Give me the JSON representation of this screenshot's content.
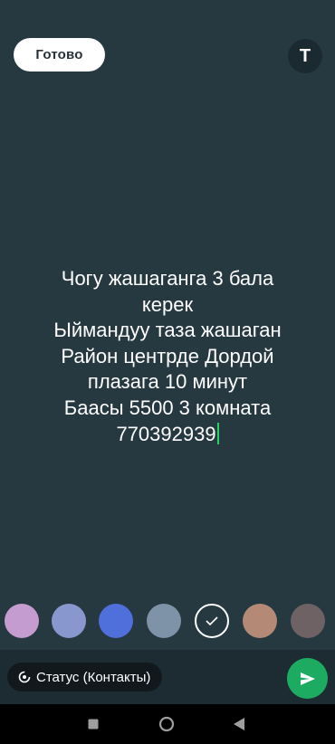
{
  "header": {
    "done_label": "Готово",
    "text_tool_label": "T"
  },
  "editor": {
    "text": "Чогу жашаганга 3 бала\nкерек\nЫймандуу таза жашаган\nРайон центрде Дордой\nплазага 10 минут\nБаасы 5500 3 комната\n770392939",
    "background_color": "#263941",
    "caret_color": "#25d366"
  },
  "palette": {
    "colors": [
      "#c59ccf",
      "#8997cf",
      "#4f6fdb",
      "#7f93a8",
      "#263941",
      "#b48a76",
      "#6f6264"
    ],
    "selected_index": 4
  },
  "composer": {
    "audience_label": "Статус (Контакты)",
    "audience_icon": "status-privacy-icon",
    "send_icon": "send-icon"
  },
  "navigation": {
    "buttons": [
      "recents-icon",
      "home-icon",
      "back-icon"
    ]
  }
}
